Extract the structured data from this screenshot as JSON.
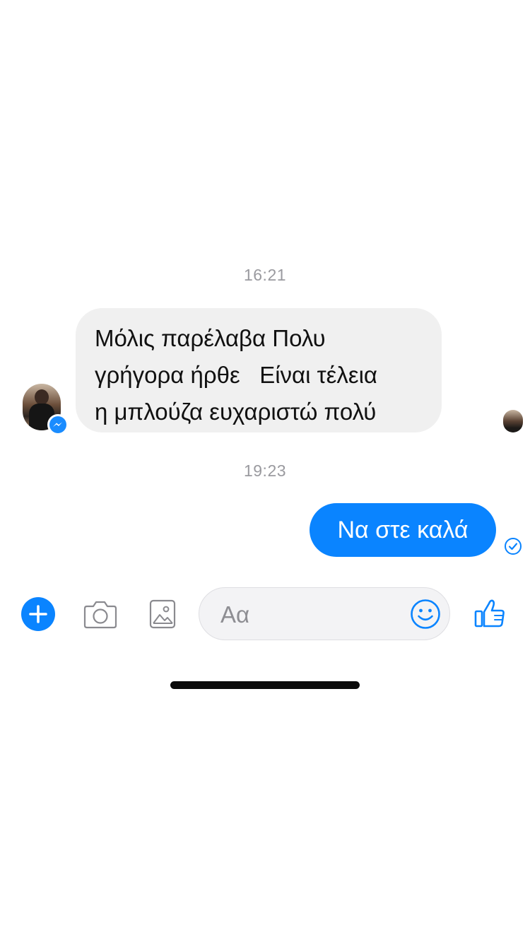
{
  "conversation": {
    "timestamps": [
      "16:21",
      "19:23"
    ],
    "incoming_message": {
      "lines": [
        "Μόλις παρέλαβα Πολυ",
        "γρήγορα ήρθε   Είναι τέλεια",
        "η μπλούζα ευχαριστώ πολύ"
      ]
    },
    "outgoing_message": {
      "text": "Να στε καλά"
    }
  },
  "composer": {
    "placeholder": "Αα"
  },
  "icons": {
    "add": "plus-icon",
    "camera": "camera-icon",
    "gallery": "image-icon",
    "emoji": "smiley-icon",
    "like": "thumbs-up-icon",
    "sent": "check-circle-icon",
    "badge": "messenger-icon"
  },
  "colors": {
    "accent": "#0a84ff",
    "incoming_bubble": "#f0f0f0",
    "timestamp": "#9a9a9f"
  }
}
